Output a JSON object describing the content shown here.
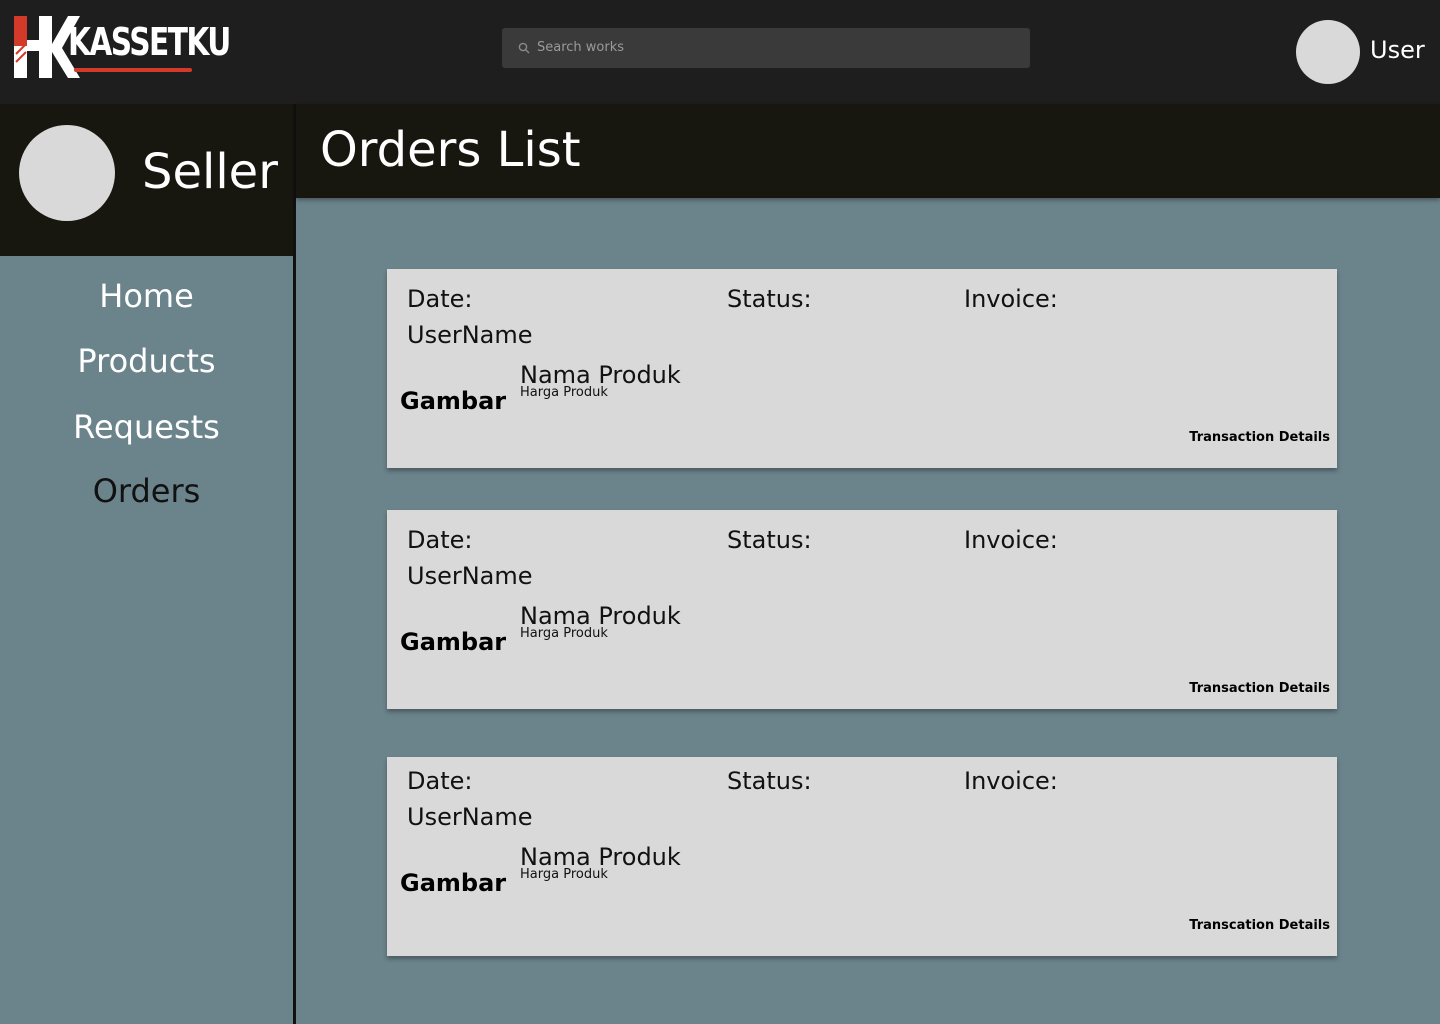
{
  "brand": {
    "logo_text": "KASSETKU"
  },
  "search": {
    "placeholder": "Search works"
  },
  "user": {
    "name": "User"
  },
  "seller": {
    "name": "Seller"
  },
  "nav": {
    "items": [
      {
        "label": "Home"
      },
      {
        "label": "Products"
      },
      {
        "label": "Requests"
      },
      {
        "label": "Orders"
      }
    ],
    "active": "Orders"
  },
  "page": {
    "title": "Orders List"
  },
  "orders": [
    {
      "date_label": "Date:",
      "status_label": "Status:",
      "invoice_label": "Invoice:",
      "username": "UserName",
      "image_label": "Gambar",
      "product_name": "Nama Produk",
      "product_price": "Harga Produk",
      "details_link": "Transaction Details"
    },
    {
      "date_label": "Date:",
      "status_label": "Status:",
      "invoice_label": "Invoice:",
      "username": "UserName",
      "image_label": "Gambar",
      "product_name": "Nama Produk",
      "product_price": "Harga Produk",
      "details_link": "Transaction Details"
    },
    {
      "date_label": "Date:",
      "status_label": "Status:",
      "invoice_label": "Invoice:",
      "username": "UserName",
      "image_label": "Gambar",
      "product_name": "Nama Produk",
      "product_price": "Harga Produk",
      "details_link": "Transcation Details"
    }
  ],
  "colors": {
    "topbar": "#1e1e1e",
    "header": "#17160f",
    "content_bg": "#6b838b",
    "card": "#d9d9d9",
    "brand_red": "#d43a2a"
  }
}
